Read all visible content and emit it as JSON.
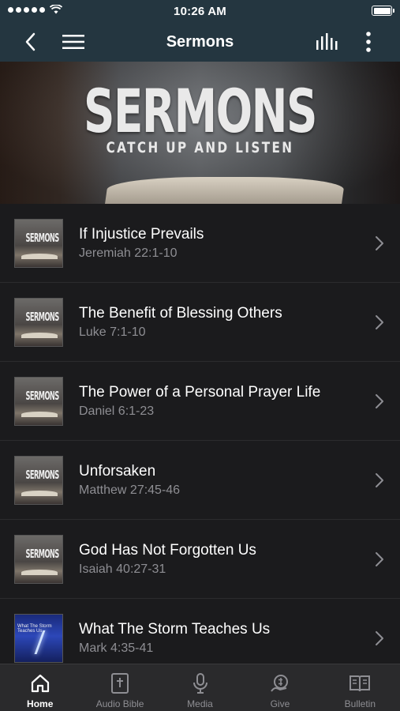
{
  "status_bar": {
    "time": "10:26 AM"
  },
  "nav": {
    "title": "Sermons"
  },
  "hero": {
    "title": "SERMONS",
    "subtitle": "CATCH UP AND LISTEN"
  },
  "sermons": [
    {
      "title": "If Injustice Prevails",
      "reference": "Jeremiah 22:1-10",
      "thumb": "sermons"
    },
    {
      "title": "The Benefit of Blessing Others",
      "reference": "Luke 7:1-10",
      "thumb": "sermons"
    },
    {
      "title": "The Power of a Personal Prayer Life",
      "reference": "Daniel 6:1-23",
      "thumb": "sermons"
    },
    {
      "title": "Unforsaken",
      "reference": "Matthew 27:45-46",
      "thumb": "sermons"
    },
    {
      "title": "God Has Not Forgotten Us",
      "reference": "Isaiah 40:27-31",
      "thumb": "sermons"
    },
    {
      "title": "What The Storm Teaches Us",
      "reference": "Mark 4:35-41",
      "thumb": "storm"
    }
  ],
  "thumb_text": {
    "sermons": "SERMONS",
    "storm": "What The Storm Teaches Us"
  },
  "tabs": [
    {
      "label": "Home",
      "icon": "home-icon",
      "active": true
    },
    {
      "label": "Audio Bible",
      "icon": "bible-icon",
      "active": false
    },
    {
      "label": "Media",
      "icon": "microphone-icon",
      "active": false
    },
    {
      "label": "Give",
      "icon": "give-icon",
      "active": false
    },
    {
      "label": "Bulletin",
      "icon": "book-icon",
      "active": false
    }
  ],
  "colors": {
    "nav_bg": "#243640",
    "list_bg": "#1b1b1d",
    "tab_bg": "#2a2a2c",
    "subtext": "#8e8e93"
  }
}
